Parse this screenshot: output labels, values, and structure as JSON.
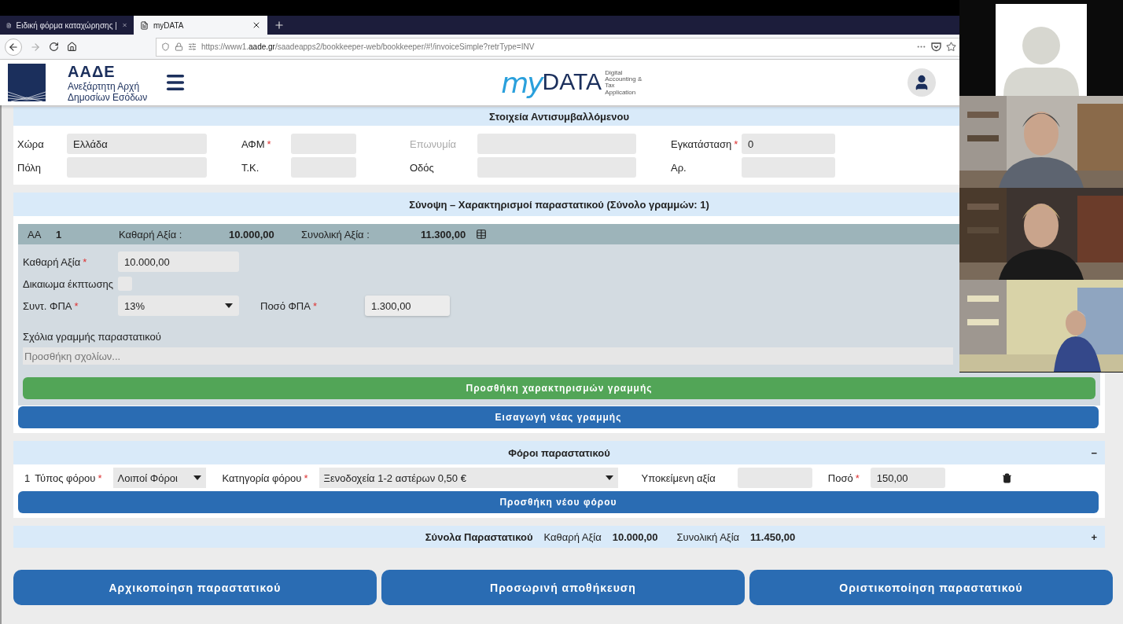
{
  "browser": {
    "tabs": [
      {
        "title": "Ειδική φόρμα καταχώρησης |",
        "selected": false
      },
      {
        "title": "myDATA",
        "selected": true
      }
    ],
    "url_prefix": "https://www1.",
    "url_domain": "aade.gr",
    "url_rest": "/saadeapps2/bookkeeper-web/bookkeeper/#!/invoiceSimple?retrType=INV"
  },
  "header": {
    "org_abbr": "ΑΑΔΕ",
    "org_name_lines": [
      "Ανεξάρτητη Αρχή",
      "Δημοσίων Εσόδων"
    ],
    "logo_my": "my",
    "logo_data": "DATA",
    "logo_tagline": [
      "Digital",
      "Accounting &",
      "Tax",
      "Application"
    ]
  },
  "counterparty": {
    "title": "Στοιχεία Αντισυμβαλλόμενου",
    "fields": [
      {
        "label": "Χώρα",
        "value": "Ελλάδα",
        "disabled": false
      },
      {
        "label": "ΑΦΜ",
        "required_mark": "*",
        "disabled": false
      },
      {
        "label": "Επωνυμία",
        "disabled": true
      },
      {
        "label": "Εγκατάσταση",
        "required_mark": "*",
        "value": "0",
        "disabled": false
      },
      {
        "label": "Πόλη",
        "disabled": false
      },
      {
        "label": "Τ.Κ.",
        "disabled": false
      },
      {
        "label": "Οδός",
        "disabled": false
      },
      {
        "label": "Αρ.",
        "disabled": false
      }
    ]
  },
  "summary": {
    "title": "Σύνοψη – Χαρακτηρισμοί παραστατικού (Σύνολο γραμμών: 1)",
    "line": {
      "aa_label": "ΑΑ",
      "aa": "1",
      "net_label": "Καθαρή Αξία :",
      "net": "10.000,00",
      "total_label": "Συνολική Αξία :",
      "total": "11.300,00",
      "net_field": {
        "label": "Καθαρή Αξία",
        "required_mark": "*",
        "value": "10.000,00"
      },
      "deduction": {
        "label": "Δικαιωμα έκπτωσης",
        "checked": false
      },
      "vat_rate": {
        "label": "Συντ. ΦΠΑ",
        "required_mark": "*",
        "value": "13%"
      },
      "vat_amount": {
        "label": "Ποσό ΦΠΑ",
        "required_mark": "*",
        "value": "1.300,00"
      },
      "comments": {
        "label": "Σχόλια γραμμής παραστατικού",
        "placeholder": "Προσθήκη σχολίων..."
      },
      "add_characterizations_button": "Προσθήκη χαρακτηρισμών γραμμής"
    },
    "new_line_button": "Εισαγωγή νέας γραμμής"
  },
  "taxes": {
    "title": "Φόροι παραστατικού",
    "toggle": "−",
    "rows": [
      {
        "index": "1",
        "type_label": "Τύπος φόρου",
        "type_mark": "*",
        "type": "Λοιποί Φόροι",
        "category_label": "Κατηγορία φόρου",
        "category_mark": "*",
        "category": "Ξενοδοχεία 1-2 αστέρων 0,50 €",
        "base_label": "Υποκείμενη αξία",
        "amount_label": "Ποσό",
        "amount_mark": "*",
        "amount": "150,00"
      }
    ],
    "add_button": "Προσθήκη νέου φόρου"
  },
  "totals": {
    "title": "Σύνολα Παραστατικού",
    "net_label": "Καθαρή Αξία",
    "net": "10.000,00",
    "total_label": "Συνολική Αξία",
    "total": "11.450,00",
    "toggle": "+"
  },
  "actions": [
    "Αρχικοποίηση παραστατικού",
    "Προσωρινή αποθήκευση",
    "Οριστικοποίηση παραστατικού"
  ],
  "video_call": {
    "tiles": [
      {
        "kind": "avatar"
      },
      {
        "kind": "picture"
      },
      {
        "kind": "picture"
      },
      {
        "kind": "picture"
      }
    ]
  }
}
